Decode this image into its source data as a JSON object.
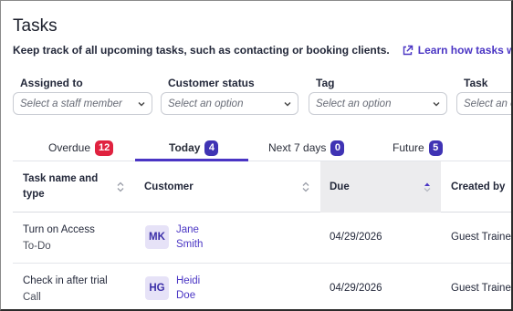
{
  "page": {
    "title": "Tasks",
    "subtitle": "Keep track of all upcoming tasks, such as contacting or booking clients.",
    "learn_link": "Learn how tasks work"
  },
  "filters": [
    {
      "label": "Assigned to",
      "placeholder": "Select a staff member"
    },
    {
      "label": "Customer status",
      "placeholder": "Select an option"
    },
    {
      "label": "Tag",
      "placeholder": "Select an option"
    },
    {
      "label": "Task type",
      "placeholder": "Select an option"
    }
  ],
  "tabs": [
    {
      "label": "Overdue",
      "count": "12",
      "color": "#e0223f"
    },
    {
      "label": "Today",
      "count": "4",
      "color": "#3f33b4",
      "active": true
    },
    {
      "label": "Next 7 days",
      "count": "0",
      "color": "#3f33b4"
    },
    {
      "label": "Future",
      "count": "5",
      "color": "#3f33b4"
    }
  ],
  "table": {
    "columns": {
      "task": "Task name and type",
      "customer": "Customer",
      "due": "Due",
      "created_by": "Created by"
    },
    "rows": [
      {
        "task": "Turn on Access",
        "type": "To-Do",
        "initials": "MK",
        "first": "Jane",
        "last": "Smith",
        "due": "04/29/2026",
        "created_by": "Guest Trainer"
      },
      {
        "task": "Check in after trial",
        "type": "Call",
        "initials": "HG",
        "first": "Heidi",
        "last": "Doe",
        "due": "04/29/2026",
        "created_by": "Guest Trainer"
      }
    ]
  },
  "colors": {
    "accent": "#4a35c4",
    "overdue": "#e0223f"
  },
  "icons": {
    "external_link": "external-link-icon",
    "chevron": "chevron-down-icon",
    "sort": "sort-icon",
    "sort_active": "sort-ascending-icon"
  }
}
